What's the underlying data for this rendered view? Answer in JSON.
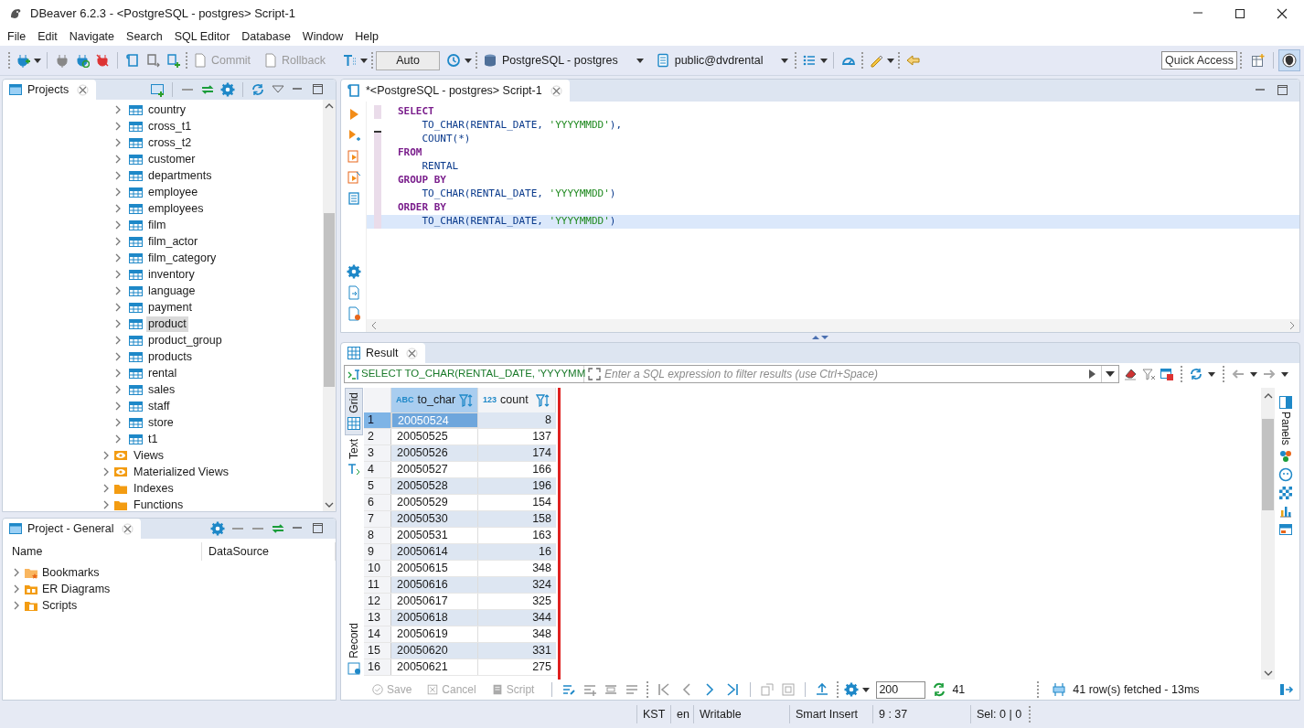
{
  "window": {
    "title": "DBeaver 6.2.3 - <PostgreSQL - postgres> Script-1"
  },
  "menu": [
    "File",
    "Edit",
    "Navigate",
    "Search",
    "SQL Editor",
    "Database",
    "Window",
    "Help"
  ],
  "toolbar": {
    "commit": {
      "label": "Commit",
      "disabled": true
    },
    "rollback": {
      "label": "Rollback",
      "disabled": true
    },
    "mode": "Auto",
    "connection": "PostgreSQL - postgres",
    "schema": "public@dvdrental",
    "quick_access": "Quick Access"
  },
  "projects_panel": {
    "title": "Projects",
    "tables": [
      {
        "label": "country",
        "selected": false
      },
      {
        "label": "cross_t1",
        "selected": false
      },
      {
        "label": "cross_t2",
        "selected": false
      },
      {
        "label": "customer",
        "selected": false
      },
      {
        "label": "departments",
        "selected": false
      },
      {
        "label": "employee",
        "selected": false
      },
      {
        "label": "employees",
        "selected": false
      },
      {
        "label": "film",
        "selected": false
      },
      {
        "label": "film_actor",
        "selected": false
      },
      {
        "label": "film_category",
        "selected": false
      },
      {
        "label": "inventory",
        "selected": false
      },
      {
        "label": "language",
        "selected": false
      },
      {
        "label": "payment",
        "selected": false
      },
      {
        "label": "product",
        "selected": true
      },
      {
        "label": "product_group",
        "selected": false
      },
      {
        "label": "products",
        "selected": false
      },
      {
        "label": "rental",
        "selected": false
      },
      {
        "label": "sales",
        "selected": false
      },
      {
        "label": "staff",
        "selected": false
      },
      {
        "label": "store",
        "selected": false
      },
      {
        "label": "t1",
        "selected": false
      }
    ],
    "folders": [
      {
        "label": "Views",
        "kind": "view"
      },
      {
        "label": "Materialized Views",
        "kind": "view"
      },
      {
        "label": "Indexes",
        "kind": "folder"
      },
      {
        "label": "Functions",
        "kind": "folder"
      }
    ]
  },
  "project_general": {
    "title": "Project - General",
    "columns": [
      "Name",
      "DataSource"
    ],
    "items": [
      {
        "label": "Bookmarks",
        "kind": "bookmarks"
      },
      {
        "label": "ER Diagrams",
        "kind": "diagrams"
      },
      {
        "label": "Scripts",
        "kind": "scripts"
      }
    ]
  },
  "editor": {
    "tab": "*<PostgreSQL - postgres> Script-1",
    "lines": [
      {
        "current": false,
        "tokens": [
          {
            "kind": "kw",
            "text": "SELECT"
          }
        ]
      },
      {
        "current": false,
        "tokens": [
          {
            "kind": "plain",
            "text": "    TO_CHAR(RENTAL_DATE, "
          },
          {
            "kind": "str",
            "text": "'YYYYMMDD'"
          },
          {
            "kind": "plain",
            "text": "),"
          }
        ]
      },
      {
        "current": false,
        "tokens": [
          {
            "kind": "plain",
            "text": "    COUNT(*)"
          }
        ]
      },
      {
        "current": false,
        "tokens": [
          {
            "kind": "kw",
            "text": "FROM"
          }
        ]
      },
      {
        "current": false,
        "tokens": [
          {
            "kind": "plain",
            "text": "    RENTAL"
          }
        ]
      },
      {
        "current": false,
        "tokens": [
          {
            "kind": "kw",
            "text": "GROUP BY"
          }
        ]
      },
      {
        "current": false,
        "tokens": [
          {
            "kind": "plain",
            "text": "    TO_CHAR(RENTAL_DATE, "
          },
          {
            "kind": "str",
            "text": "'YYYYMMDD'"
          },
          {
            "kind": "plain",
            "text": ")"
          }
        ]
      },
      {
        "current": false,
        "tokens": [
          {
            "kind": "kw",
            "text": "ORDER BY"
          }
        ]
      },
      {
        "current": true,
        "tokens": [
          {
            "kind": "plain",
            "text": "    TO_CHAR(RENTAL_DATE, "
          },
          {
            "kind": "str",
            "text": "'YYYYMMDD'"
          },
          {
            "kind": "plain",
            "text": ")"
          }
        ]
      }
    ]
  },
  "result": {
    "tab": "Result",
    "query": "SELECT TO_CHAR(RENTAL_DATE, 'YYYYMM",
    "filter_placeholder": "Enter a SQL expression to filter results (use Ctrl+Space)",
    "side_tabs": [
      {
        "label": "Grid",
        "selected": true
      },
      {
        "label": "Text",
        "selected": false
      },
      {
        "label": "Record",
        "selected": false
      }
    ],
    "panels_label": "Panels",
    "columns": [
      {
        "type": "ABC",
        "name": "to_char"
      },
      {
        "type": "123",
        "name": "count"
      }
    ],
    "rows": [
      {
        "n": "1",
        "to_char": "20050524",
        "count": "8",
        "selected": true
      },
      {
        "n": "2",
        "to_char": "20050525",
        "count": "137",
        "selected": false
      },
      {
        "n": "3",
        "to_char": "20050526",
        "count": "174",
        "selected": false
      },
      {
        "n": "4",
        "to_char": "20050527",
        "count": "166",
        "selected": false
      },
      {
        "n": "5",
        "to_char": "20050528",
        "count": "196",
        "selected": false
      },
      {
        "n": "6",
        "to_char": "20050529",
        "count": "154",
        "selected": false
      },
      {
        "n": "7",
        "to_char": "20050530",
        "count": "158",
        "selected": false
      },
      {
        "n": "8",
        "to_char": "20050531",
        "count": "163",
        "selected": false
      },
      {
        "n": "9",
        "to_char": "20050614",
        "count": "16",
        "selected": false
      },
      {
        "n": "10",
        "to_char": "20050615",
        "count": "348",
        "selected": false
      },
      {
        "n": "11",
        "to_char": "20050616",
        "count": "324",
        "selected": false
      },
      {
        "n": "12",
        "to_char": "20050617",
        "count": "325",
        "selected": false
      },
      {
        "n": "13",
        "to_char": "20050618",
        "count": "344",
        "selected": false
      },
      {
        "n": "14",
        "to_char": "20050619",
        "count": "348",
        "selected": false
      },
      {
        "n": "15",
        "to_char": "20050620",
        "count": "331",
        "selected": false
      },
      {
        "n": "16",
        "to_char": "20050621",
        "count": "275",
        "selected": false
      }
    ],
    "footer": {
      "save": {
        "label": "Save",
        "disabled": true
      },
      "cancel": {
        "label": "Cancel",
        "disabled": true
      },
      "script": {
        "label": "Script",
        "disabled": true
      },
      "fetch_size": "200",
      "row_count": "41",
      "status": "41 row(s) fetched - 13ms"
    }
  },
  "status_bar": [
    "KST",
    "en",
    "Writable",
    "Smart Insert",
    "9 : 37",
    "Sel: 0 | 0"
  ]
}
